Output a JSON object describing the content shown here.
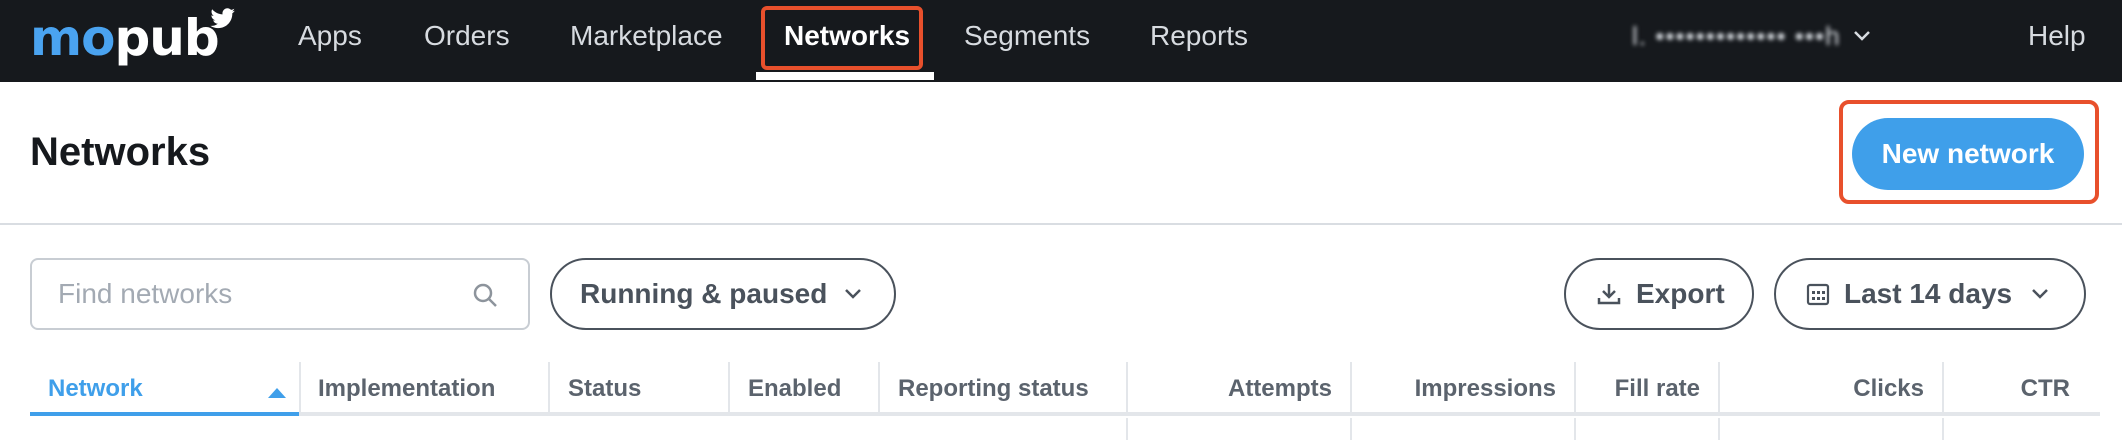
{
  "brand": {
    "logo_text": "mopub",
    "accent": "#3f9fea",
    "highlight": "#e8502c",
    "nav_bg": "#16191d"
  },
  "nav": {
    "items": [
      {
        "label": "Apps"
      },
      {
        "label": "Orders"
      },
      {
        "label": "Marketplace"
      },
      {
        "label": "Networks",
        "active": true
      },
      {
        "label": "Segments"
      },
      {
        "label": "Reports"
      }
    ],
    "user_label": "l. ••••••••••••• •••h",
    "help_label": "Help"
  },
  "header": {
    "title": "Networks",
    "new_button_label": "New network"
  },
  "filters": {
    "search_placeholder": "Find networks",
    "status_filter": "Running & paused",
    "export_label": "Export",
    "date_range": "Last 14 days"
  },
  "table": {
    "columns": [
      {
        "label": "Network",
        "sorted": "ascending"
      },
      {
        "label": "Implementation"
      },
      {
        "label": "Status"
      },
      {
        "label": "Enabled"
      },
      {
        "label": "Reporting status"
      },
      {
        "label": "Attempts"
      },
      {
        "label": "Impressions"
      },
      {
        "label": "Fill rate"
      },
      {
        "label": "Clicks"
      },
      {
        "label": "CTR"
      }
    ]
  }
}
